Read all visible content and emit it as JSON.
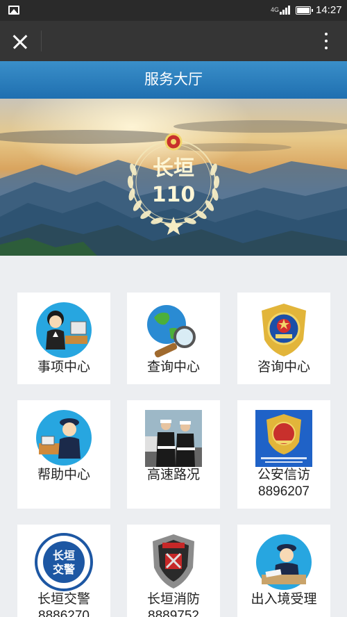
{
  "status_bar": {
    "network": "4G",
    "time": "14:27"
  },
  "page_title": "服务大厅",
  "banner": {
    "emblem_line1": "长垣",
    "emblem_line2": "110"
  },
  "tiles": [
    {
      "label": "事项中心",
      "phone": ""
    },
    {
      "label": "查询中心",
      "phone": ""
    },
    {
      "label": "咨询中心",
      "phone": ""
    },
    {
      "label": "帮助中心",
      "phone": ""
    },
    {
      "label": "高速路况",
      "phone": ""
    },
    {
      "label": "公安信访",
      "phone": "8896207"
    },
    {
      "label": "长垣交警",
      "phone": "8886270"
    },
    {
      "label": "长垣消防",
      "phone": "8889752"
    },
    {
      "label": "出入境受理",
      "phone": ""
    }
  ],
  "tile_images": {
    "traffic_badge_line1": "长垣",
    "traffic_badge_line2": "交警"
  }
}
